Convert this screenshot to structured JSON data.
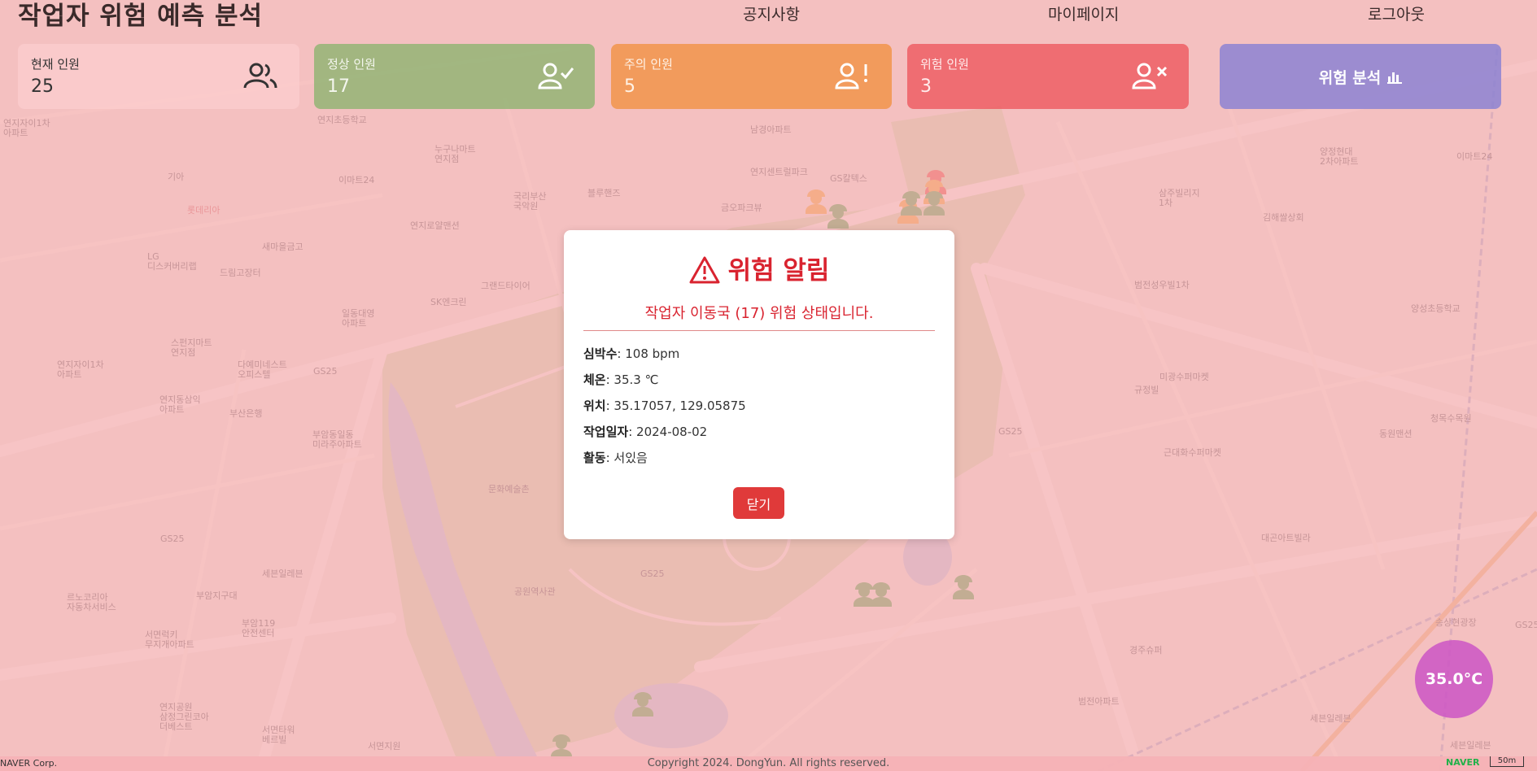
{
  "header": {
    "title": "작업자 위험 예측 분석",
    "nav": [
      "공지사항",
      "마이페이지",
      "로그아웃"
    ]
  },
  "stats": {
    "total": {
      "label": "현재 인원",
      "value": "25",
      "icon": "users-icon"
    },
    "normal": {
      "label": "정상 인원",
      "value": "17",
      "icon": "user-check-icon"
    },
    "caution": {
      "label": "주의 인원",
      "value": "5",
      "icon": "user-exclamation-icon"
    },
    "danger": {
      "label": "위험 인원",
      "value": "3",
      "icon": "user-x-icon"
    }
  },
  "analyze_button": {
    "label": "위험 분석",
    "icon": "bar-chart-icon"
  },
  "modal": {
    "title": "위험 알림",
    "message": "작업자 이동국 (17) 위험 상태입니다.",
    "rows": [
      {
        "label": "심박수",
        "value": ": 108 bpm"
      },
      {
        "label": "체온",
        "value": ": 35.3 ℃"
      },
      {
        "label": "위치",
        "value": ": 35.17057, 129.05875"
      },
      {
        "label": "작업일자",
        "value": ": 2024-08-02"
      },
      {
        "label": "활동",
        "value": ": 서있음"
      }
    ],
    "close_label": "닫기"
  },
  "temperature": "35.0°C",
  "footer": {
    "copyright": "Copyright 2024. DongYun. All rights reserved.",
    "map_corp": "NAVER Corp.",
    "naver_logo": "NAVER",
    "scale": "50m"
  },
  "map": {
    "labels": [
      "연지자이1차\n아파트",
      "연지초등학교",
      "누구나마트\n연지점",
      "기아",
      "롯데리아",
      "이마트24",
      "연지로얄맨션",
      "국리부산\n국악원",
      "블루핸즈",
      "금오파크뷰",
      "남경아파트",
      "연지센트럴파크",
      "GS칼텍스",
      "LG\n디스커버리랩",
      "새마을금고",
      "드림고장터",
      "SK엔크린",
      "그랜드타이어",
      "일동대영\n아파트",
      "스펀지마트\n연지점",
      "연지자이1차\n아파트",
      "다예미네스트\n오피스텔",
      "GS25",
      "연지동삼익\n아파트",
      "부산은행",
      "부암동일동\n미라주아파트",
      "문화예술촌",
      "GS25",
      "세븐일레븐",
      "르노코리아\n자동차서비스",
      "부암지구대",
      "서면럭키\n무지개아파트",
      "부암119\n안전센터",
      "공원역사관",
      "GS25",
      "연지공원\n삼정그린코아\n더베스트",
      "서면타워\n베르빌",
      "서면지원",
      "삼주빌리지\n1차",
      "김해쌀상회",
      "양정현대\n2차아파트",
      "이마트24",
      "범전성우빌1차",
      "양성초등학교",
      "미광수퍼마켓",
      "규정빌",
      "GS25",
      "동원맨션",
      "청목수목원",
      "근대화수퍼마켓",
      "대곤아트빌라",
      "경주슈퍼",
      "범전아파트",
      "세븐일레븐",
      "세븐일레븐",
      "송상현광장",
      "GS25"
    ]
  }
}
